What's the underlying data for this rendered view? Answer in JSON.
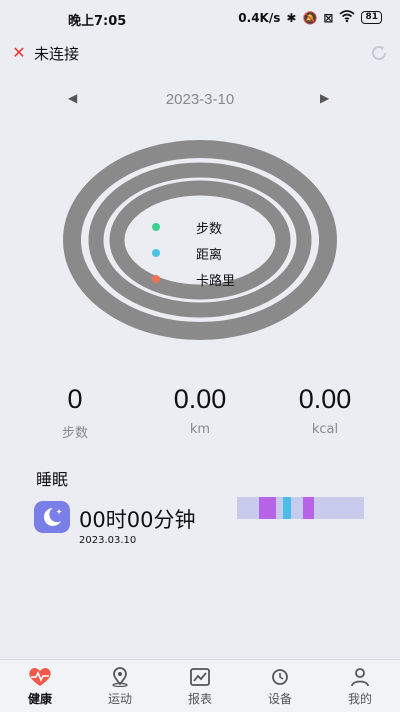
{
  "status_bar": {
    "time": "晚上7:05",
    "speed": "0.4K/s",
    "battery": "81"
  },
  "header": {
    "connection_status": "未连接"
  },
  "date_nav": {
    "date": "2023-3-10"
  },
  "rings_legend": [
    {
      "label": "步数",
      "color": "#3ecf8e"
    },
    {
      "label": "距离",
      "color": "#4cc3e6"
    },
    {
      "label": "卡路里",
      "color": "#f07250"
    }
  ],
  "stats": [
    {
      "value": "0",
      "unit": "步数"
    },
    {
      "value": "0.00",
      "unit": "km"
    },
    {
      "value": "0.00",
      "unit": "kcal"
    }
  ],
  "sleep": {
    "title": "睡眠",
    "duration": "00时00分钟",
    "date": "2023.03.10",
    "bar_colors": {
      "track": "#c9cbee",
      "deep": "#b763e8",
      "awake": "#48bde8"
    }
  },
  "tabs": [
    {
      "label": "健康",
      "icon": "heart-pulse-icon"
    },
    {
      "label": "运动",
      "icon": "location-pin-icon"
    },
    {
      "label": "报表",
      "icon": "chart-icon"
    },
    {
      "label": "设备",
      "icon": "watch-icon"
    },
    {
      "label": "我的",
      "icon": "user-icon"
    }
  ],
  "colors": {
    "background": "#ecedf3",
    "ring": "#8a8a8a",
    "accent_red": "#e0342f"
  }
}
